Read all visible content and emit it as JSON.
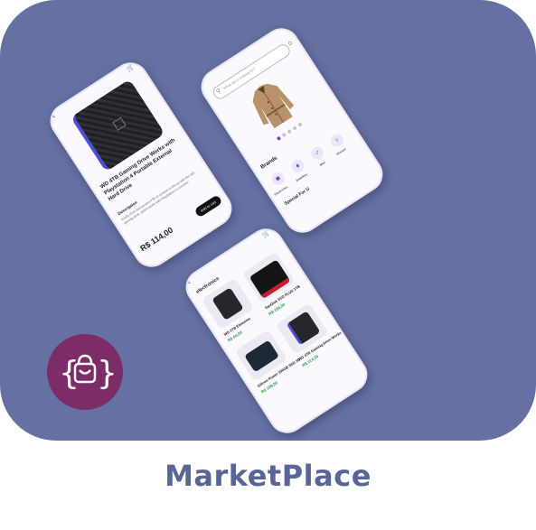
{
  "app": {
    "name": "MarketPlace",
    "brand_color": "#6571a2",
    "logo_color": "#7c2c66"
  },
  "detail_screen": {
    "product_title": "WD 4TB Gaming Drive Works with Playstation 4 Portable External Hard Drive",
    "description_label": "Description",
    "description_text": "Easily store and access 4TB of content on the go with the WD gaming drive, which works with PlayStation 4 consoles",
    "price": "R$ 114,00",
    "cta_label": "Add to cart"
  },
  "home_screen": {
    "search_placeholder": "What are u looking for?",
    "brands_label": "Brands",
    "brands": [
      "Electronics",
      "Jewellery",
      "Men",
      "Women"
    ],
    "section_label": "Special For U"
  },
  "list_screen": {
    "category_title": "electronics",
    "products": [
      {
        "name": "WD 2TB Elements",
        "price": "R$ 64,00"
      },
      {
        "name": "SanDisk SSD PLUS 1TB",
        "price": "R$ 109,00"
      },
      {
        "name": "Silicon Power 256GB SSD 3D",
        "price": "R$ 109,00"
      },
      {
        "name": "WD 4TB Gaming Drive Works with",
        "price": "R$ 114,00"
      }
    ]
  },
  "icons": [
    "cart-icon",
    "search-icon",
    "home-icon",
    "back-icon",
    "shopping-bag-icon"
  ]
}
